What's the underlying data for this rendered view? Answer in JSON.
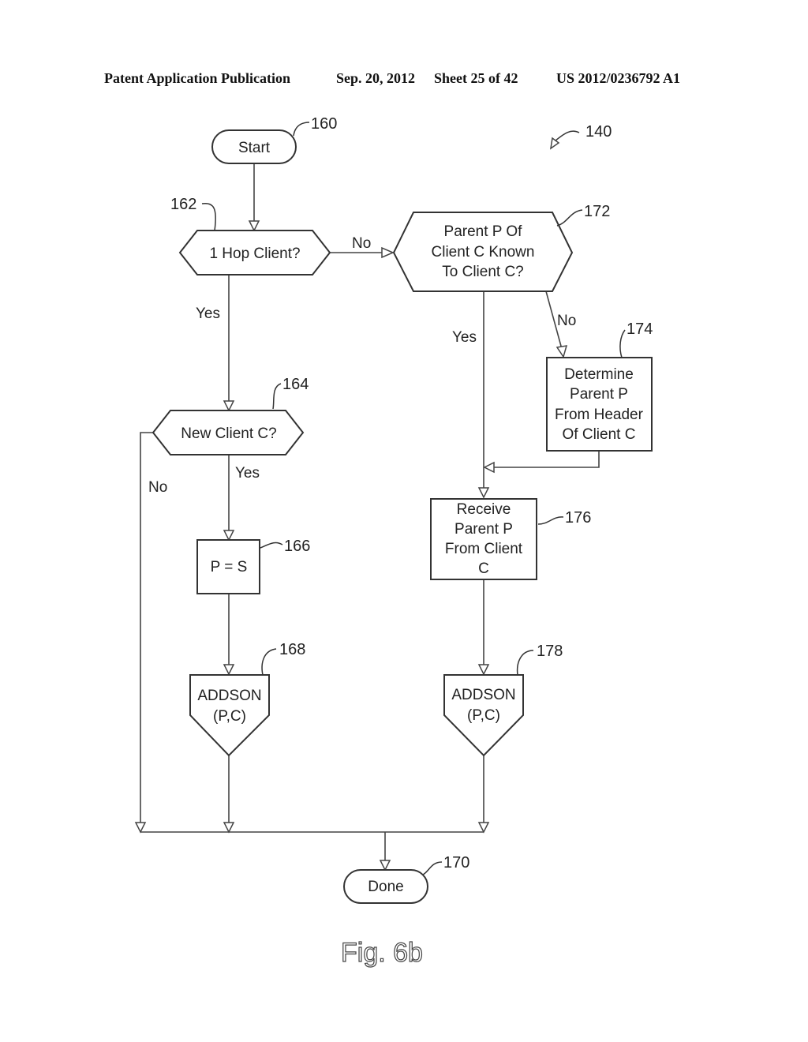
{
  "header": {
    "left": "Patent Application Publication",
    "date": "Sep. 20, 2012",
    "sheet": "Sheet 25 of 42",
    "number": "US 2012/0236792 A1"
  },
  "figure": {
    "caption": "Fig. 6b",
    "ref": "140"
  },
  "nodes": {
    "start": {
      "ref": "160",
      "lines": [
        "Start"
      ]
    },
    "hop": {
      "ref": "162",
      "lines": [
        "1 Hop Client?"
      ]
    },
    "newclient": {
      "ref": "164",
      "lines": [
        "New Client C?"
      ]
    },
    "ps": {
      "ref": "166",
      "lines": [
        "P = S"
      ]
    },
    "addson1": {
      "ref": "168",
      "lines": [
        "ADDSON",
        "(P,C)"
      ]
    },
    "done": {
      "ref": "170",
      "lines": [
        "Done"
      ]
    },
    "known": {
      "ref": "172",
      "lines": [
        "Parent P Of",
        "Client C Known",
        "To Client C?"
      ]
    },
    "determine": {
      "ref": "174",
      "lines": [
        "Determine",
        "Parent P",
        "From Header",
        "Of Client C"
      ]
    },
    "receive": {
      "ref": "176",
      "lines": [
        "Receive",
        "Parent P",
        "From Client",
        "C"
      ]
    },
    "addson2": {
      "ref": "178",
      "lines": [
        "ADDSON",
        "(P,C)"
      ]
    }
  },
  "edge_labels": {
    "hop_no": "No",
    "hop_yes": "Yes",
    "newclient_no": "No",
    "newclient_yes": "Yes",
    "known_yes": "Yes",
    "known_no": "No"
  }
}
